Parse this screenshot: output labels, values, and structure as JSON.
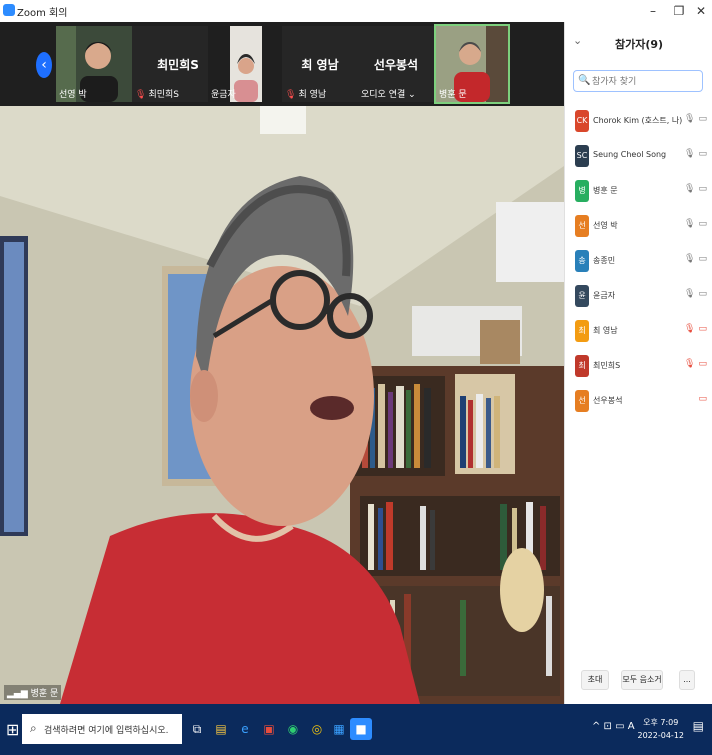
{
  "window": {
    "title": "Zoom 회의",
    "minimize": "–",
    "maximize": "❐",
    "close": "✕"
  },
  "strip": {
    "nav_glyph": "‹",
    "tiles": [
      {
        "caption": "선영 박",
        "big": "",
        "muted": false
      },
      {
        "caption": "최민희S",
        "big": "최민희S",
        "muted": true
      },
      {
        "caption": "윤금자",
        "big": "",
        "muted": false
      },
      {
        "caption": "최 영남",
        "big": "최 영남",
        "muted": true
      },
      {
        "caption": "오디오 연결 ⌄",
        "big": "선우봉석",
        "muted": false
      },
      {
        "caption": "병훈 문",
        "big": "",
        "muted": false
      }
    ]
  },
  "main_video": {
    "caption": "병훈 문",
    "signal": "▂▄▆"
  },
  "panel": {
    "collapse": "⌄",
    "title": "참가자(9)",
    "search_placeholder": "참가자 찾기",
    "search_icon": "🔍",
    "participants": [
      {
        "initials": "CK",
        "name": "Chorok Kim (호스트, 나)",
        "color": "#d9472b",
        "mic": "🎙",
        "cam": "▭",
        "mic_off": false,
        "cam_off": false
      },
      {
        "initials": "SC",
        "name": "Seung Cheol Song",
        "color": "#2c3e50",
        "mic": "🎙",
        "cam": "▭",
        "mic_off": false,
        "cam_off": false
      },
      {
        "initials": "병",
        "name": "병훈 문",
        "color": "#27ae60",
        "mic": "🎙",
        "cam": "▭",
        "mic_off": false,
        "cam_off": false
      },
      {
        "initials": "선",
        "name": "선영 박",
        "color": "#e67e22",
        "mic": "🎙",
        "cam": "▭",
        "mic_off": false,
        "cam_off": false
      },
      {
        "initials": "송",
        "name": "송종민",
        "color": "#2980b9",
        "mic": "🎙",
        "cam": "▭",
        "mic_off": false,
        "cam_off": false
      },
      {
        "initials": "윤",
        "name": "윤금자",
        "color": "#34495e",
        "mic": "🎙",
        "cam": "▭",
        "mic_off": false,
        "cam_off": false
      },
      {
        "initials": "최",
        "name": "최 영남",
        "color": "#f39c12",
        "mic": "🎙",
        "cam": "▭",
        "mic_off": true,
        "cam_off": true
      },
      {
        "initials": "최",
        "name": "최민희S",
        "color": "#c0392b",
        "mic": "🎙",
        "cam": "▭",
        "mic_off": true,
        "cam_off": true
      },
      {
        "initials": "선",
        "name": "선우봉석",
        "color": "#e67e22",
        "mic": "",
        "cam": "▭",
        "mic_off": false,
        "cam_off": true
      }
    ],
    "invite": "초대",
    "mute_all": "모두 음소거",
    "more": "..."
  },
  "taskbar": {
    "start": "⊞",
    "search_placeholder": "검색하려면 여기에 입력하십시오.",
    "search_glyph": "⌕",
    "apps": [
      "⧉",
      "▤",
      "e",
      "▣",
      "◉",
      "◎",
      "▦",
      "■"
    ],
    "tray": "^ ⊡ ▭ A",
    "time": "오후 7:09",
    "date": "2022-04-12",
    "notif": "▤"
  }
}
